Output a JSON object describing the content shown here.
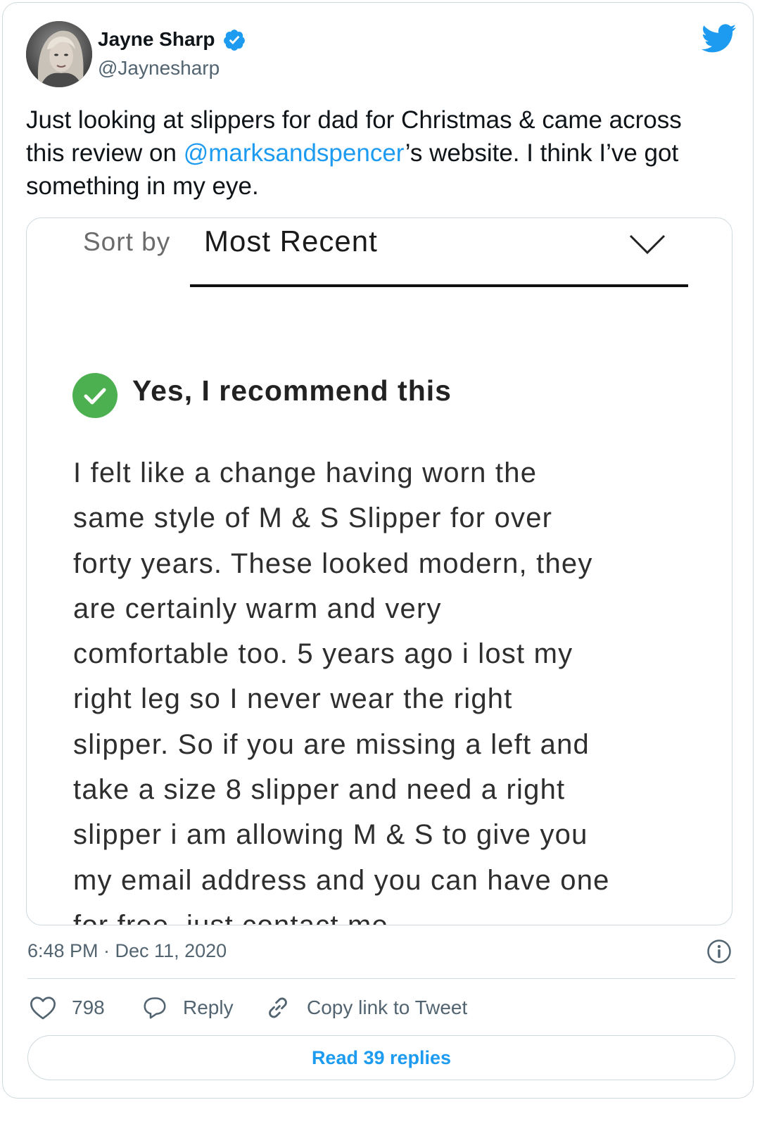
{
  "author": {
    "name": "Jayne Sharp",
    "handle": "@Jaynesharp",
    "verified": true
  },
  "tweet": {
    "text_before": "Just looking at slippers for dad for Christmas & came across this review on ",
    "mention": "@marksandspencer",
    "text_after": "’s website. I think I’ve got something in my eye."
  },
  "screenshot": {
    "sort_label": "Sort by",
    "sort_value": "Most Recent",
    "recommend_text": "Yes, I recommend this",
    "review_lines": [
      "I felt like a change having worn the",
      "same style of M & S Slipper for over",
      "forty years. These looked modern, they",
      "are certainly warm and very",
      "comfortable too. 5 years ago i lost my",
      "right leg so I never wear the right",
      "slipper. So if you are missing a left and",
      "take a size 8 slipper and need a right",
      "slipper i am allowing M & S to give you",
      "my email address and you can have one",
      "for free, just contact me"
    ]
  },
  "meta": {
    "timestamp": "6:48 PM · Dec 11, 2020"
  },
  "actions": {
    "likes": "798",
    "reply": "Reply",
    "copy_link": "Copy link to Tweet",
    "read_replies": "Read 39 replies"
  },
  "colors": {
    "accent": "#1d9bf0",
    "check_green": "#4caf50",
    "secondary_text": "#536471",
    "border": "#cfd9de"
  },
  "icons": {
    "logo": "twitter-bird-icon",
    "verified": "verified-badge-icon",
    "check": "check-circle-icon",
    "chevron": "chevron-down-icon",
    "info": "info-icon",
    "like": "heart-icon",
    "reply": "reply-bubble-icon",
    "link": "link-icon"
  }
}
